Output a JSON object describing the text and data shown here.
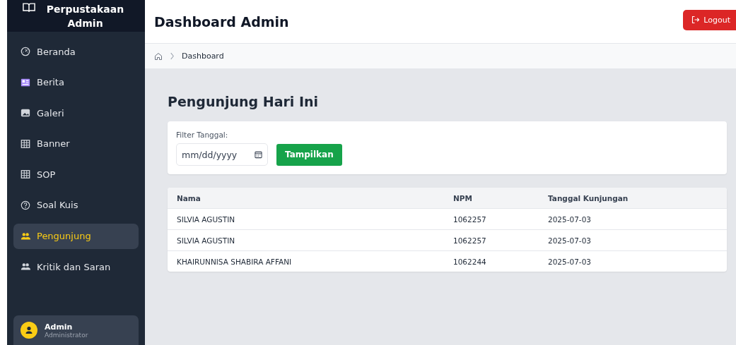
{
  "sidebar": {
    "brand": "Perpustakaan Admin",
    "items": [
      {
        "label": "Beranda",
        "selected": false
      },
      {
        "label": "Berita",
        "selected": false
      },
      {
        "label": "Galeri",
        "selected": false
      },
      {
        "label": "Banner",
        "selected": false
      },
      {
        "label": "SOP",
        "selected": false
      },
      {
        "label": "Soal Kuis",
        "selected": false
      },
      {
        "label": "Pengunjung",
        "selected": true
      },
      {
        "label": "Kritik dan Saran",
        "selected": false
      }
    ],
    "user": {
      "name": "Admin",
      "role": "Administrator"
    }
  },
  "header": {
    "title": "Dashboard Admin",
    "logout": "Logout"
  },
  "breadcrumb": [
    "Dashboard"
  ],
  "page_title": "Pengunjung Hari Ini",
  "filter": {
    "label": "Filter Tanggal:",
    "placeholder": "mm/dd/yyyy",
    "button": "Tampilkan"
  },
  "table": {
    "columns": [
      "Nama",
      "NPM",
      "Tanggal Kunjungan"
    ],
    "rows": [
      [
        "SILVIA AGUSTIN",
        "1062257",
        "2025-07-03"
      ],
      [
        "SILVIA AGUSTIN",
        "1062257",
        "2025-07-03"
      ],
      [
        "KHAIRUNNISA SHABIRA AFFANI",
        "1062244",
        "2025-07-03"
      ]
    ]
  }
}
